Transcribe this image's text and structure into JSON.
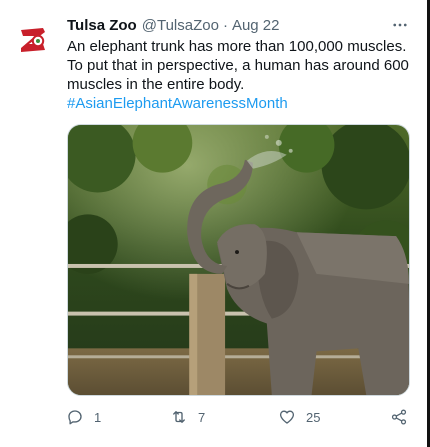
{
  "tweet": {
    "author_name": "Tulsa Zoo",
    "handle": "@TulsaZoo",
    "separator": "·",
    "timestamp": "Aug 22",
    "text": "An elephant trunk has more than 100,000 muscles. To put that in perspective, a human has around 600 muscles in the entire body.",
    "hashtag": "#AsianElephantAwarenessMonth",
    "media": {
      "alt": "Asian elephant raising its trunk and spraying water, with trees and a wooden fence behind"
    }
  },
  "actions": {
    "reply_count": "1",
    "retweet_count": "7",
    "like_count": "25"
  },
  "colors": {
    "accent": "#1d9bf0",
    "secondary_text": "#536471",
    "brand_red": "#c8202b"
  },
  "icons": {
    "avatar": "tulsa-zoo-logo",
    "more": "more-dots-icon",
    "reply": "reply-icon",
    "retweet": "retweet-icon",
    "like": "heart-icon",
    "share": "share-icon"
  }
}
